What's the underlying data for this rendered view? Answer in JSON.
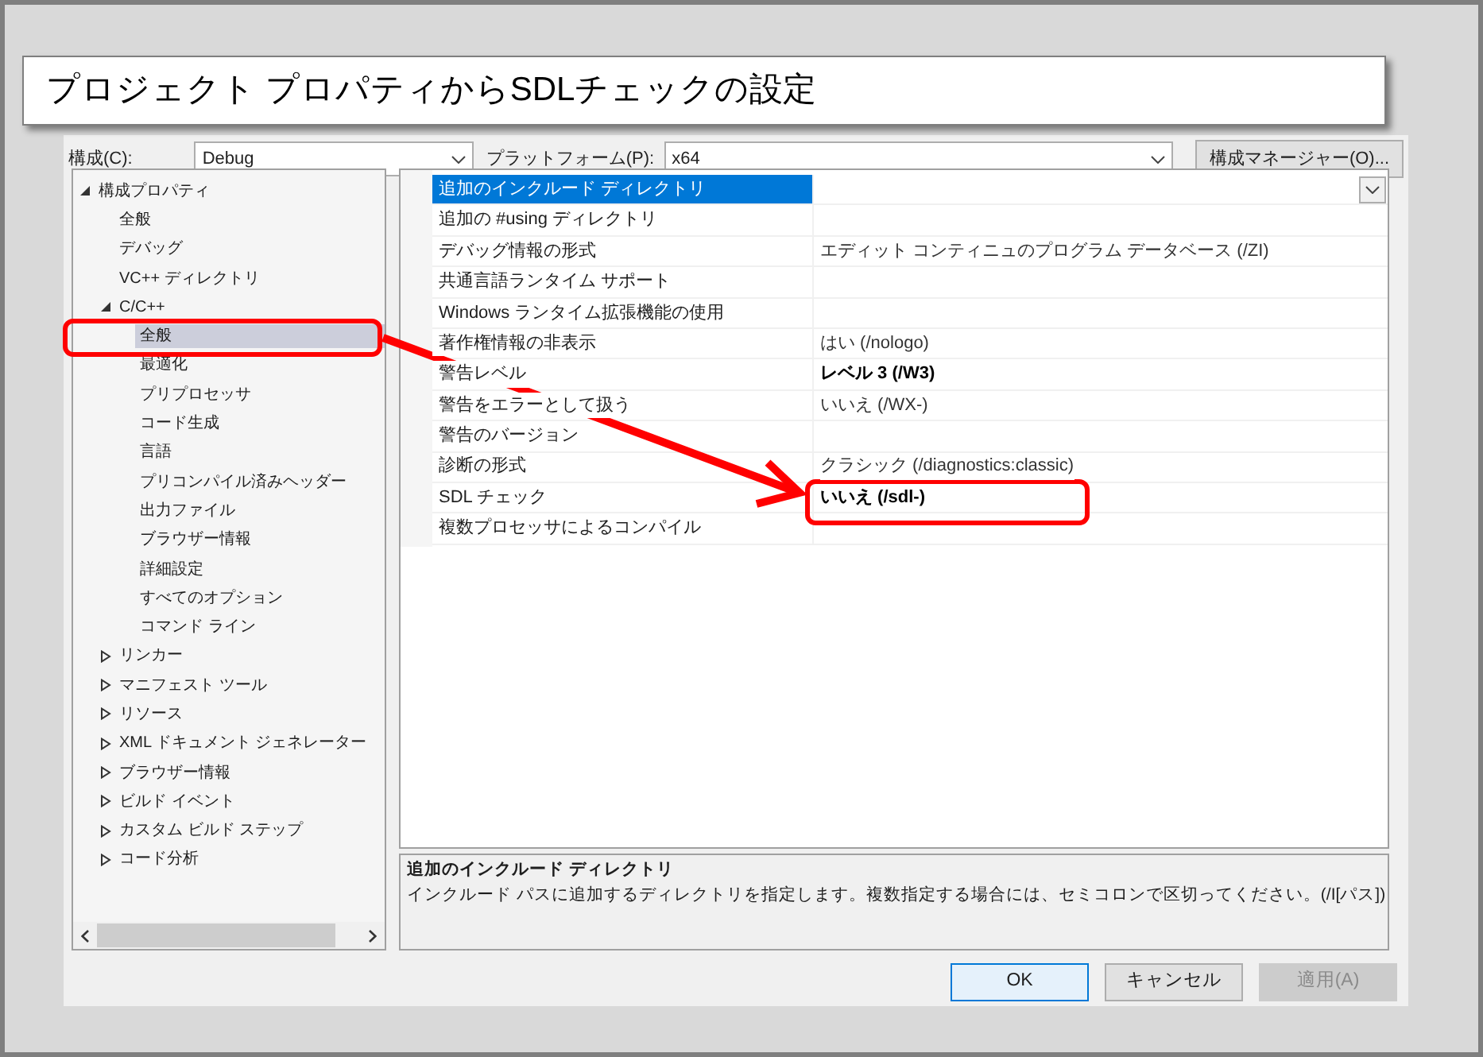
{
  "banner": {
    "title": "プロジェクト プロパティからSDLチェックの設定"
  },
  "toolbar": {
    "configuration_label": "構成(C):",
    "configuration_value": "Debug",
    "platform_label": "プラットフォーム(P):",
    "platform_value": "x64",
    "manager_button": "構成マネージャー(O)..."
  },
  "tree": [
    {
      "label": "構成プロパティ",
      "selected": false,
      "expanded": true,
      "children": [
        {
          "label": "全般",
          "selected": false
        },
        {
          "label": "デバッグ",
          "selected": false
        },
        {
          "label": "VC++ ディレクトリ",
          "selected": false
        },
        {
          "label": "C/C++",
          "selected": false,
          "expanded": true,
          "children": [
            {
              "label": "全般",
              "selected": true
            },
            {
              "label": "最適化",
              "selected": false
            },
            {
              "label": "プリプロセッサ",
              "selected": false
            },
            {
              "label": "コード生成",
              "selected": false
            },
            {
              "label": "言語",
              "selected": false
            },
            {
              "label": "プリコンパイル済みヘッダー",
              "selected": false
            },
            {
              "label": "出力ファイル",
              "selected": false
            },
            {
              "label": "ブラウザー情報",
              "selected": false
            },
            {
              "label": "詳細設定",
              "selected": false
            },
            {
              "label": "すべてのオプション",
              "selected": false
            },
            {
              "label": "コマンド ライン",
              "selected": false
            }
          ]
        },
        {
          "label": "リンカー",
          "selected": false,
          "expanded": false
        },
        {
          "label": "マニフェスト ツール",
          "selected": false,
          "expanded": false
        },
        {
          "label": "リソース",
          "selected": false,
          "expanded": false
        },
        {
          "label": "XML ドキュメント ジェネレーター",
          "selected": false,
          "expanded": false
        },
        {
          "label": "ブラウザー情報",
          "selected": false,
          "expanded": false
        },
        {
          "label": "ビルド イベント",
          "selected": false,
          "expanded": false
        },
        {
          "label": "カスタム ビルド ステップ",
          "selected": false,
          "expanded": false
        },
        {
          "label": "コード分析",
          "selected": false,
          "expanded": false
        }
      ]
    }
  ],
  "properties": [
    {
      "name": "追加のインクルード ディレクトリ",
      "selected": true
    },
    {
      "name": "追加の #using ディレクトリ",
      "selected": false
    },
    {
      "name": "デバッグ情報の形式",
      "value": "エディット コンティニュのプログラム データベース (/ZI)",
      "selected": false,
      "modified": false
    },
    {
      "name": "共通言語ランタイム サポート",
      "selected": false
    },
    {
      "name": "Windows ランタイム拡張機能の使用",
      "selected": false
    },
    {
      "name": "著作権情報の非表示",
      "value": "はい (/nologo)",
      "selected": false,
      "modified": false
    },
    {
      "name": "警告レベル",
      "value": "レベル 3 (/W3)",
      "selected": false,
      "modified": true
    },
    {
      "name": "警告をエラーとして扱う",
      "value": "いいえ (/WX-)",
      "selected": false,
      "modified": false
    },
    {
      "name": "警告のバージョン",
      "selected": false
    },
    {
      "name": "診断の形式",
      "value": "クラシック (/diagnostics:classic)",
      "selected": false,
      "modified": false
    },
    {
      "name": "SDL チェック",
      "value": "いいえ (/sdl-)",
      "selected": false,
      "modified": true
    },
    {
      "name": "複数プロセッサによるコンパイル",
      "selected": false
    }
  ],
  "description": {
    "title": "追加のインクルード ディレクトリ",
    "text": "インクルード パスに追加するディレクトリを指定します。複数指定する場合には、セミコロンで区切ってください。(/I[パス])"
  },
  "buttons": [
    {
      "label": "OK",
      "kind": "default",
      "disabled": false
    },
    {
      "label": "キャンセル",
      "kind": "normal",
      "disabled": false
    },
    {
      "label": "適用(A)",
      "kind": "normal",
      "disabled": true
    }
  ]
}
